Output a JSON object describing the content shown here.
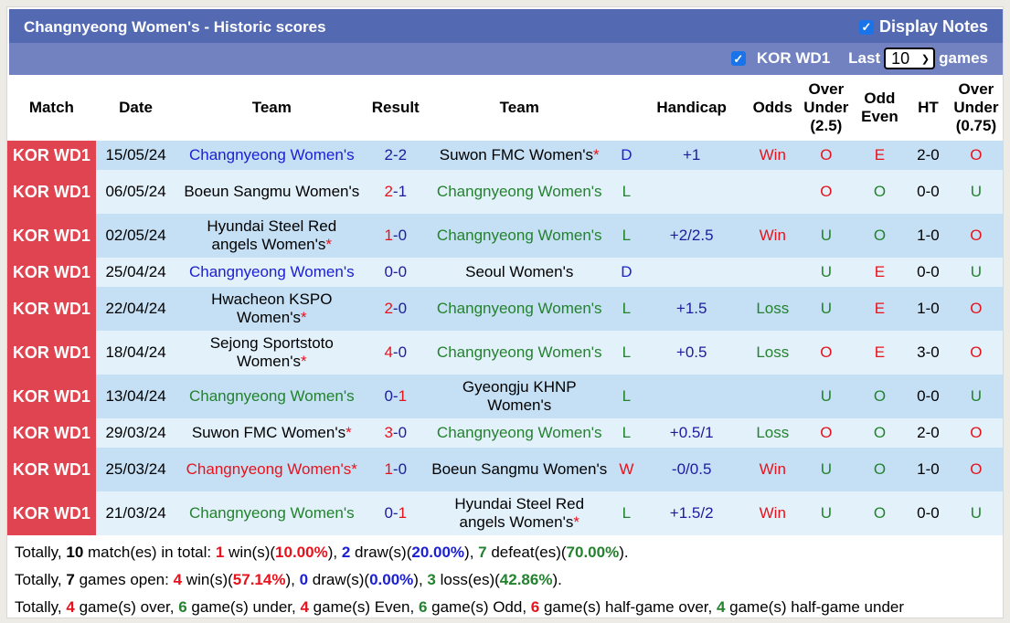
{
  "header": {
    "title": "Changnyeong Women's - Historic scores",
    "display_notes_label": "Display Notes",
    "display_notes_checked": true
  },
  "filter": {
    "league_label": "KOR WD1",
    "league_checked": true,
    "last_label": "Last",
    "games_count": "10",
    "games_label": "games"
  },
  "columns": {
    "match": "Match",
    "date": "Date",
    "team1": "Team",
    "result": "Result",
    "team2": "Team",
    "handicap": "Handicap",
    "odds": "Odds",
    "ou_line1": "Over",
    "ou_line2": "Under",
    "ou_line3": "(2.5)",
    "oe_line1": "Odd",
    "oe_line2": "Even",
    "ht": "HT",
    "ht_ou_line1": "Over",
    "ht_ou_line2": "Under",
    "ht_ou_line3": "(0.75)"
  },
  "rows": [
    {
      "league": "KOR WD1",
      "date": "15/05/24",
      "home": "Changnyeong Women's",
      "home_star": "",
      "home_color": "blue",
      "score_home": "2",
      "score_away": "2",
      "away": "Suwon FMC Women's",
      "away_star": "*",
      "away_color": "black",
      "outcome": "D",
      "handicap": "+1",
      "odds": "Win",
      "ou": "O",
      "oe": "E",
      "ht": "2-0",
      "ht_ou": "O"
    },
    {
      "league": "KOR WD1",
      "date": "06/05/24",
      "home": "Boeun Sangmu Women's",
      "home_star": "",
      "home_color": "black",
      "score_home": "2",
      "score_away": "1",
      "away": "Changnyeong Women's",
      "away_star": "",
      "away_color": "green",
      "outcome": "L",
      "handicap": "",
      "odds": "",
      "ou": "O",
      "oe": "O",
      "ht": "0-0",
      "ht_ou": "U"
    },
    {
      "league": "KOR WD1",
      "date": "02/05/24",
      "home": "Hyundai Steel Red angels Women's",
      "home_star": "*",
      "home_color": "black",
      "score_home": "1",
      "score_away": "0",
      "away": "Changnyeong Women's",
      "away_star": "",
      "away_color": "green",
      "outcome": "L",
      "handicap": "+2/2.5",
      "odds": "Win",
      "ou": "U",
      "oe": "O",
      "ht": "1-0",
      "ht_ou": "O"
    },
    {
      "league": "KOR WD1",
      "date": "25/04/24",
      "home": "Changnyeong Women's",
      "home_star": "",
      "home_color": "blue",
      "score_home": "0",
      "score_away": "0",
      "away": "Seoul Women's",
      "away_star": "",
      "away_color": "black",
      "outcome": "D",
      "handicap": "",
      "odds": "",
      "ou": "U",
      "oe": "E",
      "ht": "0-0",
      "ht_ou": "U"
    },
    {
      "league": "KOR WD1",
      "date": "22/04/24",
      "home": "Hwacheon KSPO Women's",
      "home_star": "*",
      "home_color": "black",
      "score_home": "2",
      "score_away": "0",
      "away": "Changnyeong Women's",
      "away_star": "",
      "away_color": "green",
      "outcome": "L",
      "handicap": "+1.5",
      "odds": "Loss",
      "ou": "U",
      "oe": "E",
      "ht": "1-0",
      "ht_ou": "O"
    },
    {
      "league": "KOR WD1",
      "date": "18/04/24",
      "home": "Sejong Sportstoto Women's",
      "home_star": "*",
      "home_color": "black",
      "score_home": "4",
      "score_away": "0",
      "away": "Changnyeong Women's",
      "away_star": "",
      "away_color": "green",
      "outcome": "L",
      "handicap": "+0.5",
      "odds": "Loss",
      "ou": "O",
      "oe": "E",
      "ht": "3-0",
      "ht_ou": "O"
    },
    {
      "league": "KOR WD1",
      "date": "13/04/24",
      "home": "Changnyeong Women's",
      "home_star": "",
      "home_color": "green",
      "score_home": "0",
      "score_away": "1",
      "away": "Gyeongju KHNP Women's",
      "away_star": "",
      "away_color": "black",
      "outcome": "L",
      "handicap": "",
      "odds": "",
      "ou": "U",
      "oe": "O",
      "ht": "0-0",
      "ht_ou": "U"
    },
    {
      "league": "KOR WD1",
      "date": "29/03/24",
      "home": "Suwon FMC Women's",
      "home_star": "*",
      "home_color": "black",
      "score_home": "3",
      "score_away": "0",
      "away": "Changnyeong Women's",
      "away_star": "",
      "away_color": "green",
      "outcome": "L",
      "handicap": "+0.5/1",
      "odds": "Loss",
      "ou": "O",
      "oe": "O",
      "ht": "2-0",
      "ht_ou": "O"
    },
    {
      "league": "KOR WD1",
      "date": "25/03/24",
      "home": "Changnyeong Women's",
      "home_star": "*",
      "home_color": "red",
      "score_home": "1",
      "score_away": "0",
      "away": "Boeun Sangmu Women's",
      "away_star": "",
      "away_color": "black",
      "outcome": "W",
      "handicap": "-0/0.5",
      "odds": "Win",
      "ou": "U",
      "oe": "O",
      "ht": "1-0",
      "ht_ou": "O"
    },
    {
      "league": "KOR WD1",
      "date": "21/03/24",
      "home": "Changnyeong Women's",
      "home_star": "",
      "home_color": "green",
      "score_home": "0",
      "score_away": "1",
      "away": "Hyundai Steel Red angels Women's",
      "away_star": "*",
      "away_color": "black",
      "outcome": "L",
      "handicap": "+1.5/2",
      "odds": "Win",
      "ou": "U",
      "oe": "O",
      "ht": "0-0",
      "ht_ou": "U"
    }
  ],
  "summary": {
    "line1": {
      "prefix": "Totally, ",
      "total": "10",
      "t1": " match(es) in total: ",
      "wins": "1",
      "t2": " win(s)(",
      "win_pct": "10.00%",
      "t3": "), ",
      "draws": "2",
      "t4": " draw(s)(",
      "draw_pct": "20.00%",
      "t5": "), ",
      "defeats": "7",
      "t6": " defeat(es)(",
      "defeat_pct": "70.00%",
      "t7": ")."
    },
    "line2": {
      "prefix": "Totally, ",
      "open": "7",
      "t1": " games open: ",
      "wins": "4",
      "t2": " win(s)(",
      "win_pct": "57.14%",
      "t3": "), ",
      "draws": "0",
      "t4": " draw(s)(",
      "draw_pct": "0.00%",
      "t5": "), ",
      "losses": "3",
      "t6": " loss(es)(",
      "loss_pct": "42.86%",
      "t7": ")."
    },
    "line3": {
      "prefix": "Totally, ",
      "over": "4",
      "t1": " game(s) over, ",
      "under": "6",
      "t2": " game(s) under, ",
      "even": "4",
      "t3": " game(s) Even, ",
      "odd": "6",
      "t4": " game(s) Odd, ",
      "half_over": "6",
      "t5": " game(s) half-game over, ",
      "half_under": "4",
      "t6": " game(s) half-game under"
    }
  },
  "colors": {
    "title_bar": "#5369b2",
    "filter_bar": "#7282c0",
    "league_badge": "#e04450",
    "row_odd": "#c5e0f4",
    "row_even": "#e3f1fb",
    "win_red": "#e8121c",
    "draw_blue": "#1c20d0",
    "loss_green": "#23822d"
  }
}
